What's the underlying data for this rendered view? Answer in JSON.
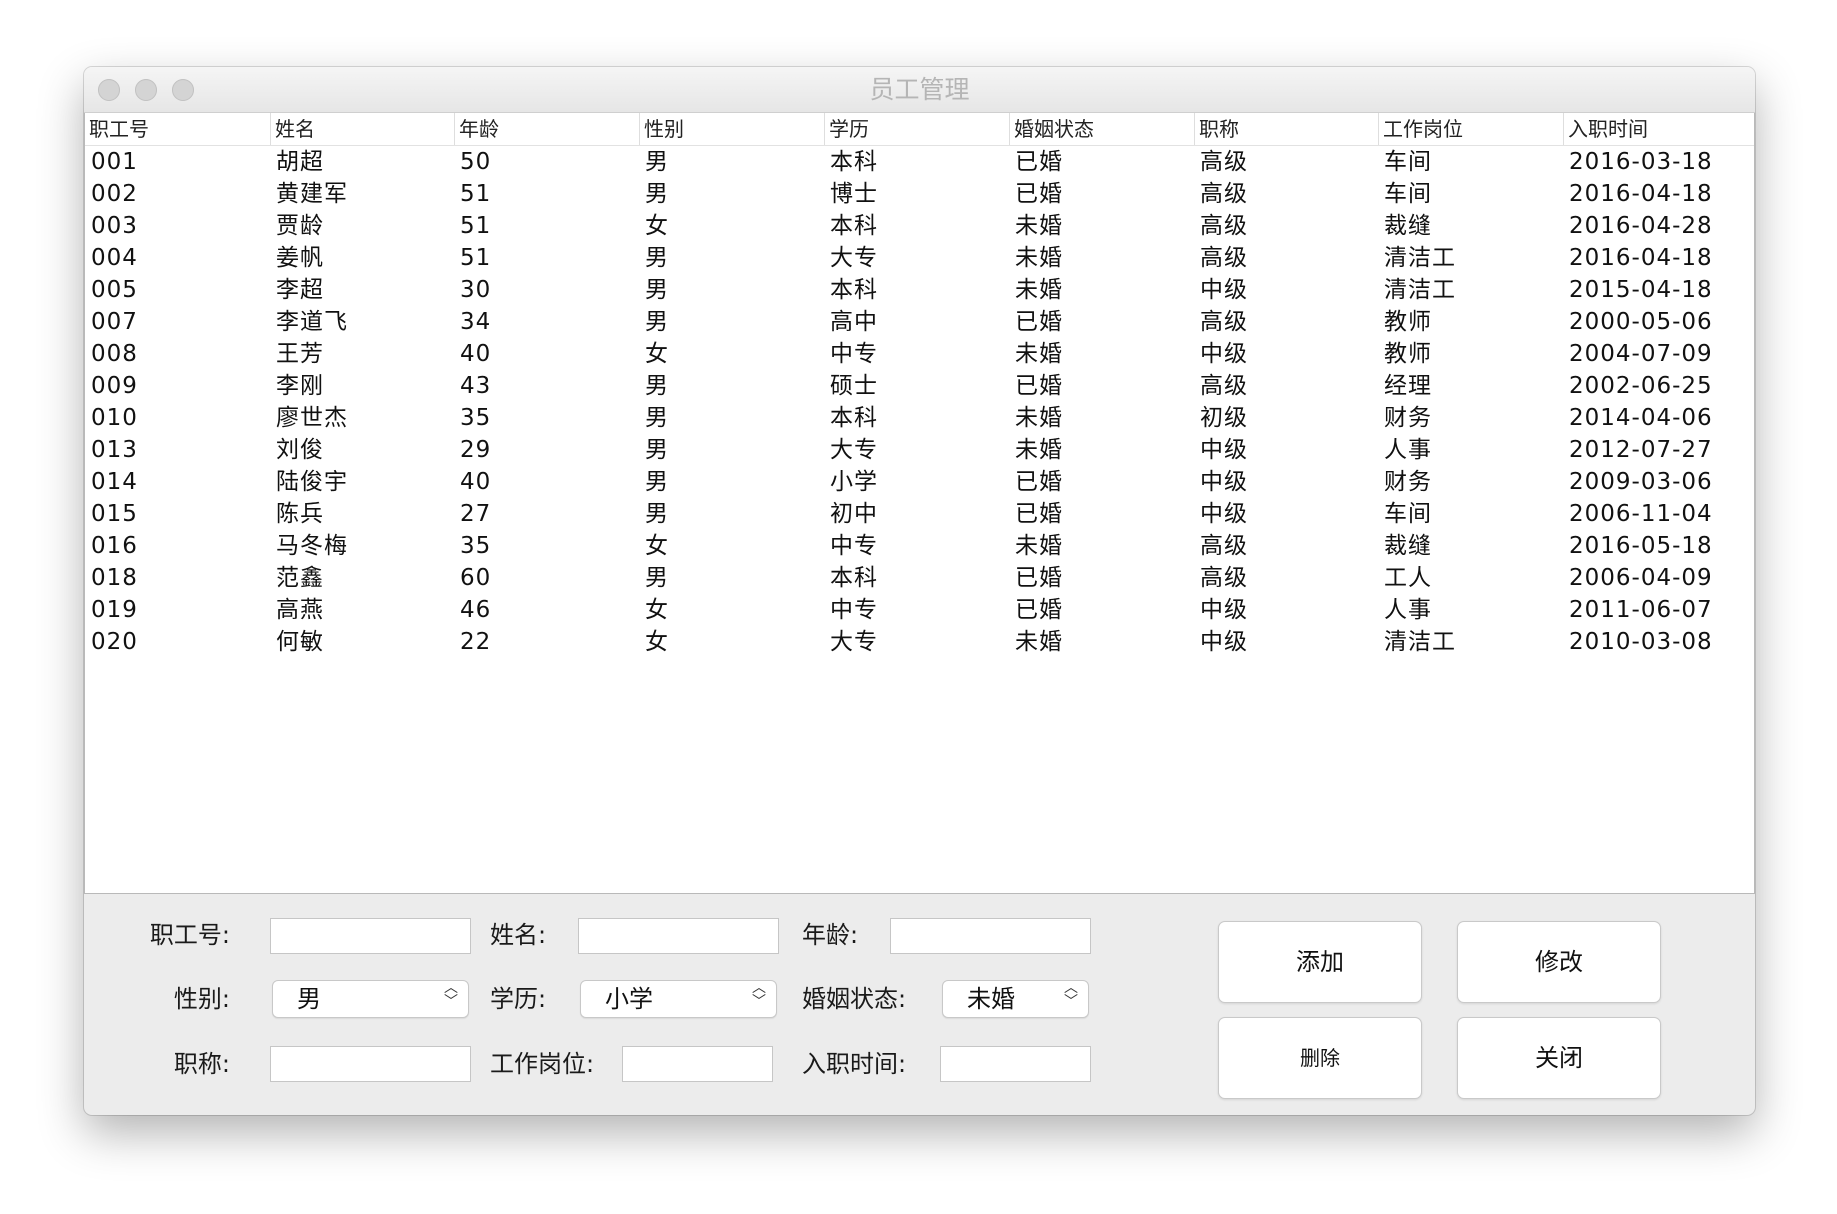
{
  "window": {
    "title": "员工管理"
  },
  "table": {
    "columns": [
      "职工号",
      "姓名",
      "年龄",
      "性别",
      "学历",
      "婚姻状态",
      "职称",
      "工作岗位",
      "入职时间"
    ],
    "rows": [
      [
        "001",
        "胡超",
        "50",
        "男",
        "本科",
        "已婚",
        "高级",
        "车间",
        "2016-03-18"
      ],
      [
        "002",
        "黄建军",
        "51",
        "男",
        "博士",
        "已婚",
        "高级",
        "车间",
        "2016-04-18"
      ],
      [
        "003",
        "贾龄",
        "51",
        "女",
        "本科",
        "未婚",
        "高级",
        "裁缝",
        "2016-04-28"
      ],
      [
        "004",
        "姜帆",
        "51",
        "男",
        "大专",
        "未婚",
        "高级",
        "清洁工",
        "2016-04-18"
      ],
      [
        "005",
        "李超",
        "30",
        "男",
        "本科",
        "未婚",
        "中级",
        "清洁工",
        "2015-04-18"
      ],
      [
        "007",
        "李道飞",
        "34",
        "男",
        "高中",
        "已婚",
        "高级",
        "教师",
        "2000-05-06"
      ],
      [
        "008",
        "王芳",
        "40",
        "女",
        "中专",
        "未婚",
        "中级",
        "教师",
        "2004-07-09"
      ],
      [
        "009",
        "李刚",
        "43",
        "男",
        "硕士",
        "已婚",
        "高级",
        "经理",
        "2002-06-25"
      ],
      [
        "010",
        "廖世杰",
        "35",
        "男",
        "本科",
        "未婚",
        "初级",
        "财务",
        "2014-04-06"
      ],
      [
        "013",
        "刘俊",
        "29",
        "男",
        "大专",
        "未婚",
        "中级",
        "人事",
        "2012-07-27"
      ],
      [
        "014",
        "陆俊宇",
        "40",
        "男",
        "小学",
        "已婚",
        "中级",
        "财务",
        "2009-03-06"
      ],
      [
        "015",
        "陈兵",
        "27",
        "男",
        "初中",
        "已婚",
        "中级",
        "车间",
        "2006-11-04"
      ],
      [
        "016",
        "马冬梅",
        "35",
        "女",
        "中专",
        "未婚",
        "高级",
        "裁缝",
        "2016-05-18"
      ],
      [
        "018",
        "范鑫",
        "60",
        "男",
        "本科",
        "已婚",
        "高级",
        "工人",
        "2006-04-09"
      ],
      [
        "019",
        "高燕",
        "46",
        "女",
        "中专",
        "已婚",
        "中级",
        "人事",
        "2011-06-07"
      ],
      [
        "020",
        "何敏",
        "22",
        "女",
        "大专",
        "未婚",
        "中级",
        "清洁工",
        "2010-03-08"
      ]
    ]
  },
  "form": {
    "labels": {
      "id": "职工号:",
      "name": "姓名:",
      "age": "年龄:",
      "gender": "性别:",
      "education": "学历:",
      "marital": "婚姻状态:",
      "title": "职称:",
      "position": "工作岗位:",
      "hire_date": "入职时间:"
    },
    "values": {
      "id": "",
      "name": "",
      "age": "",
      "title": "",
      "position": "",
      "hire_date": ""
    },
    "selects": {
      "gender": "男",
      "education": "小学",
      "marital": "未婚"
    }
  },
  "buttons": {
    "add": "添加",
    "edit": "修改",
    "delete": "删除",
    "close": "关闭"
  }
}
